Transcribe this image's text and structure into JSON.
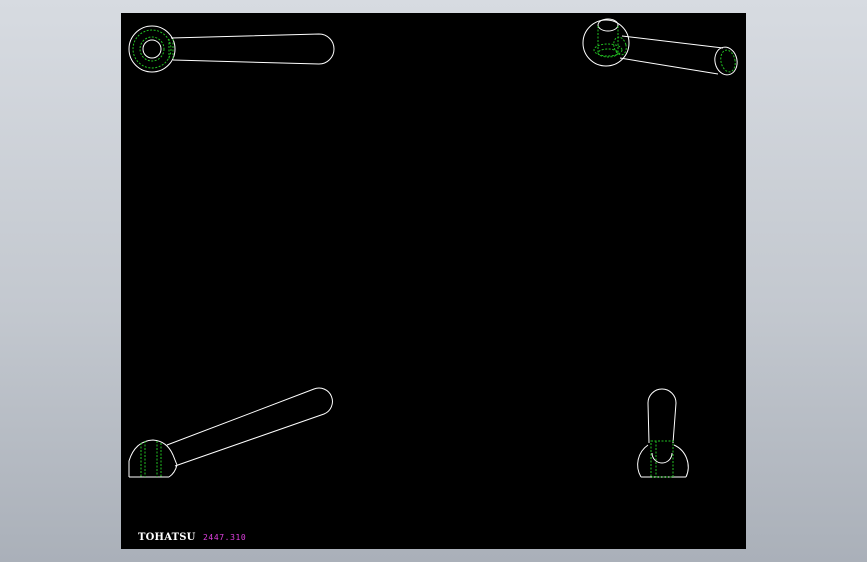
{
  "title_block": {
    "brand": "TOHATSU",
    "part_number": "2447.310"
  },
  "colors": {
    "background": "#000000",
    "outline": "#ffffff",
    "hidden_line": "#22c022",
    "part_number": "#e040e0",
    "brand": "#ffffff"
  },
  "views": [
    {
      "name": "top-view"
    },
    {
      "name": "isometric-view"
    },
    {
      "name": "front-view"
    },
    {
      "name": "side-view"
    }
  ]
}
